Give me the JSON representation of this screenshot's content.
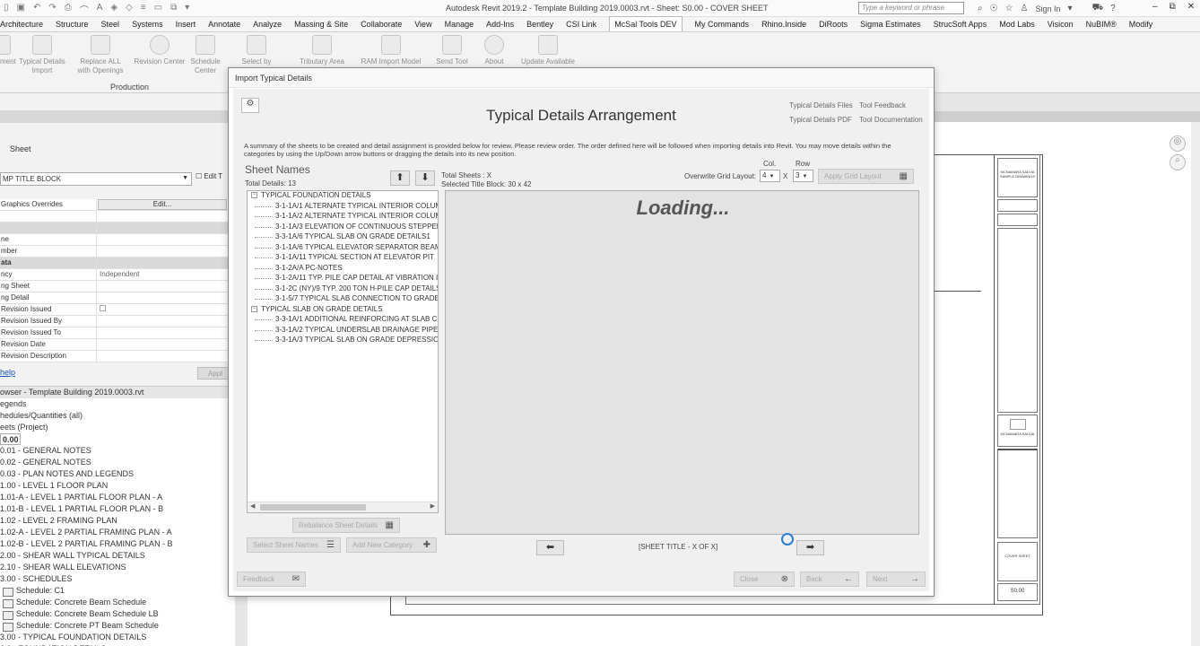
{
  "titlebar": {
    "app_title": "Autodesk Revit 2019.2 - Template Building 2019.0003.rvt - Sheet: S0.00 - COVER SHEET",
    "search_placeholder": "Type a keyword or phrase",
    "sign_in": "Sign In"
  },
  "ribbon_tabs": [
    "Architecture",
    "Structure",
    "Steel",
    "Systems",
    "Insert",
    "Annotate",
    "Analyze",
    "Massing & Site",
    "Collaborate",
    "View",
    "Manage",
    "Add-Ins",
    "Bentley",
    "CSI Link",
    "McSal Tools DEV",
    "My Commands",
    "Rhino.Inside",
    "DiRoots",
    "Sigma Estimates",
    "StrucSoft Apps",
    "Mod Labs",
    "Visicon",
    "NuBIM®",
    "Modify"
  ],
  "active_tab": "McSal Tools DEV",
  "ribbon_buttons": {
    "b0": "ment",
    "b1": "Typical Details Import",
    "b2": "Replace ALL with Openings",
    "b3": "Revision Center",
    "b4": "Schedule Center",
    "b5": "Select by",
    "b6": "Tributary Area",
    "b7": "RAM Import Model",
    "b8": "Send Tool",
    "b9": "About",
    "b10": "Update Available",
    "group": "Production"
  },
  "properties": {
    "type_name": "Sheet",
    "type_selector": "MP TITLE BLOCK",
    "edit_type": "Edit T",
    "rows": [
      {
        "k": "Graphics Overrides",
        "v": "",
        "btn": "Edit..."
      },
      {
        "k": "",
        "v": ""
      },
      {
        "k": "",
        "v": "",
        "sec": true
      },
      {
        "k": "ne",
        "v": ""
      },
      {
        "k": "mber",
        "v": ""
      },
      {
        "k": "ata",
        "v": "",
        "sec": true
      },
      {
        "k": "ncy",
        "v": "Independent"
      },
      {
        "k": "ng Sheet",
        "v": ""
      },
      {
        "k": "ng Detail",
        "v": ""
      },
      {
        "k": "Revision Issued",
        "v": "",
        "chk": true
      },
      {
        "k": "Revision Issued By",
        "v": ""
      },
      {
        "k": "Revision Issued To",
        "v": ""
      },
      {
        "k": "Revision Date",
        "v": ""
      },
      {
        "k": "Revision Description",
        "v": ""
      }
    ],
    "help": "help",
    "apply": "Appl"
  },
  "browser": {
    "header": "owser - Template Building 2019.0003.rvt",
    "items": [
      {
        "t": "egends"
      },
      {
        "t": "hedules/Quantities (all)"
      },
      {
        "t": "eets (Project)"
      },
      {
        "t": "0.00 - COVER SHEET",
        "sel": true
      },
      {
        "t": "0.01 - GENERAL NOTES"
      },
      {
        "t": "0.02 - GENERAL NOTES"
      },
      {
        "t": "0.03 - PLAN NOTES AND LEGENDS"
      },
      {
        "t": "1.00 - LEVEL 1 FLOOR PLAN"
      },
      {
        "t": "1.01-A - LEVEL 1 PARTIAL FLOOR PLAN - A"
      },
      {
        "t": "1.01-B - LEVEL 1 PARTIAL FLOOR PLAN - B"
      },
      {
        "t": "1.02 - LEVEL 2 FRAMING PLAN"
      },
      {
        "t": "1.02-A - LEVEL 2 PARTIAL FRAMING PLAN - A"
      },
      {
        "t": "1.02-B - LEVEL 2 PARTIAL FRAMING PLAN - B"
      },
      {
        "t": "2.00 - SHEAR WALL TYPICAL DETAILS"
      },
      {
        "t": "2.10 - SHEAR WALL ELEVATIONS"
      },
      {
        "t": "3.00 - SCHEDULES"
      },
      {
        "t": "Schedule: C1",
        "sched": true
      },
      {
        "t": "Schedule: Concrete Beam Schedule",
        "sched": true
      },
      {
        "t": "Schedule: Concrete Beam Schedule LB",
        "sched": true
      },
      {
        "t": "Schedule: Concrete PT Beam Schedule",
        "sched": true
      },
      {
        "t": "3.00 - TYPICAL FOUNDATION DETAILS"
      },
      {
        "t": "3.0 - FOUNDATION DETAILS"
      }
    ]
  },
  "dialog": {
    "title": "Import Typical Details",
    "heading": "Typical Details Arrangement",
    "link_files": "Typical Details Files",
    "link_pdf": "Typical Details PDF",
    "link_feedback": "Tool Feedback",
    "link_docs": "Tool Documentation",
    "description": "A summary of the sheets to be created and detail assignment is provided below for review. Please review order. The order defined here will be followed when importing details into Revit. You may move details within the categories by using the Up/Down arrow buttons or dragging the details into its new position.",
    "sheet_names": "Sheet Names",
    "total_details": "Total Details: 13",
    "total_sheets": "Total Sheets : X",
    "selected_title_block": "Selected Title Block: 30 x 42",
    "col_label": "Col.",
    "row_label": "Row",
    "overwrite_label": "Overwrite Grid Layout:",
    "col_value": "4",
    "row_value": "3",
    "times": "X",
    "apply_layout": "Apply Grid Layout",
    "tree": [
      {
        "t": "TYPICAL FOUNDATION DETAILS",
        "grp": true
      },
      {
        "t": "3-1-1A/1 ALTERNATE TYPICAL INTERIOR COLUMN"
      },
      {
        "t": "3-1-1A/2 ALTERNATE TYPICAL INTERIOR COLUMN"
      },
      {
        "t": "3-1-1A/3 ELEVATION OF CONTINUOUS STEPPED"
      },
      {
        "t": "3-3-1A/6 TYPICAL SLAB ON GRADE DETAILS1"
      },
      {
        "t": "3-1-1A/6 TYPICAL ELEVATOR SEPARATOR BEAM"
      },
      {
        "t": "3-1-1A/11 TYPICAL SECTION AT ELEVATOR PIT"
      },
      {
        "t": "3-1-2A/A PC-NOTES"
      },
      {
        "t": "3-1-2A/11 TYP. PILE CAP DETAIL AT VIBRATION I"
      },
      {
        "t": "3-1-2C (NY)/9 TYP. 200 TON H-PILE CAP DETAILS"
      },
      {
        "t": "3-1-5/7 TYPICAL SLAB CONNECTION TO GRADE"
      },
      {
        "t": "TYPICAL SLAB ON GRADE DETAILS",
        "grp": true
      },
      {
        "t": "3-3-1A/1 ADDITIONAL REINFORCING AT SLAB CC"
      },
      {
        "t": "3-3-1A/2 TYPICAL UNDERSLAB DRAINAGE PIPE"
      },
      {
        "t": "3-3-1A/3 TYPICAL SLAB ON GRADE DEPRESSION"
      }
    ],
    "loading": "Loading...",
    "sheet_title": "[SHEET TITLE - X OF X]",
    "btn_rebalance": "Rebalance Sheet Details",
    "btn_select_all": "Select Sheet Names",
    "btn_add": "Add New Category",
    "btn_feedback": "Feedback",
    "btn_close": "Close",
    "btn_back": "Back",
    "btn_next": "Next"
  },
  "titleblock": {
    "firm_top": "MCNAMARA SALVIA SAMPLE DRAWINGS",
    "firm_logo": "MCNAMARA SALVIA",
    "sheet_name": "COVER SHEET",
    "sheet_no": "S0.00"
  }
}
